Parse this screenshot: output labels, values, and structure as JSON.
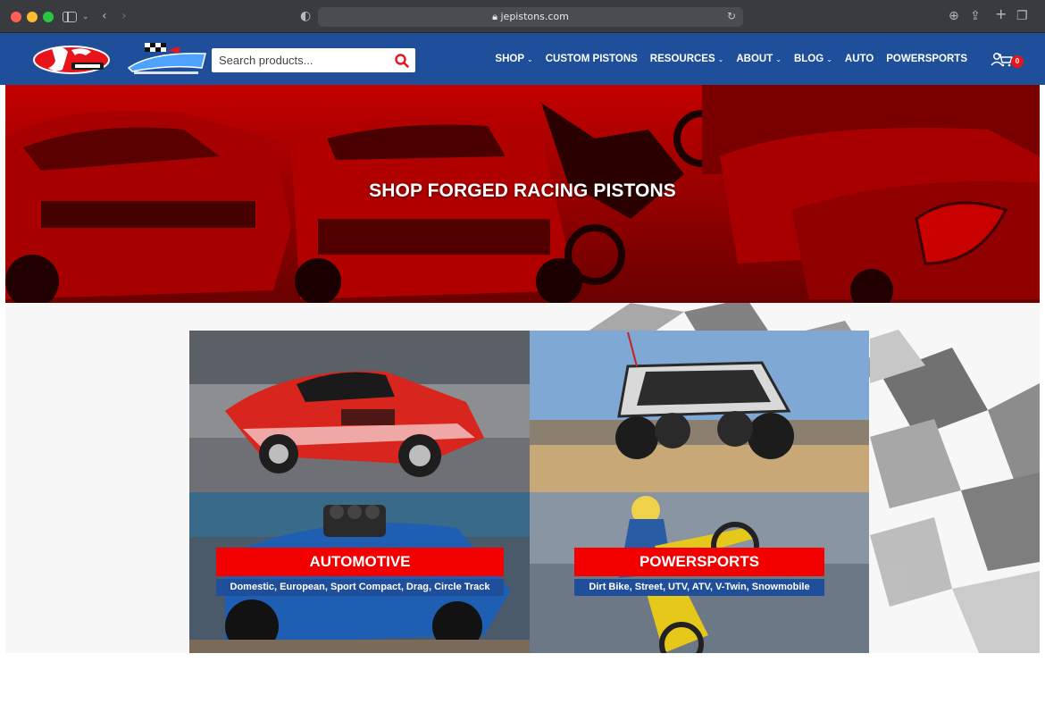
{
  "browser": {
    "url": "jepistons.com"
  },
  "header": {
    "search_placeholder": "Search products...",
    "nav": [
      {
        "label": "SHOP",
        "dropdown": true
      },
      {
        "label": "CUSTOM PISTONS",
        "dropdown": false
      },
      {
        "label": "RESOURCES",
        "dropdown": true
      },
      {
        "label": "ABOUT",
        "dropdown": true
      },
      {
        "label": "BLOG",
        "dropdown": true
      },
      {
        "label": "AUTO",
        "dropdown": false
      },
      {
        "label": "POWERSPORTS",
        "dropdown": false
      }
    ],
    "cart_count": "0",
    "colors": {
      "bar": "#1f4e9a",
      "accent": "#e8141c"
    }
  },
  "hero": {
    "title": "SHOP FORGED RACING PISTONS"
  },
  "categories": {
    "automotive": {
      "title": "AUTOMOTIVE",
      "subtitle": "Domestic, European, Sport Compact, Drag, Circle Track"
    },
    "powersports": {
      "title": "POWERSPORTS",
      "subtitle": "Dirt Bike, Street, UTV, ATV, V-Twin, Snowmobile"
    }
  },
  "icons": {
    "search": "search-icon",
    "user": "user-icon",
    "cart": "cart-icon"
  }
}
